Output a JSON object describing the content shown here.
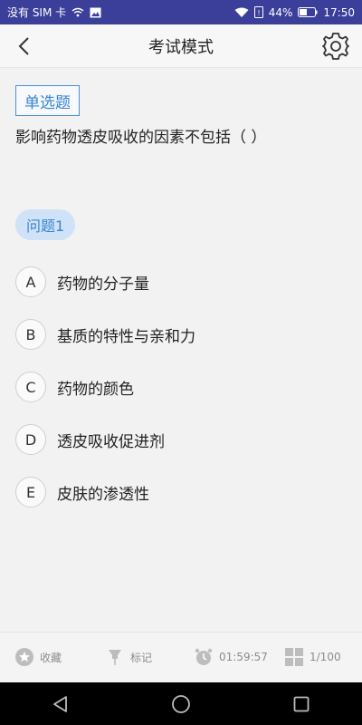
{
  "status_bar": {
    "carrier": "没有 SIM 卡",
    "battery": "44%",
    "time": "17:50"
  },
  "nav": {
    "title": "考试模式"
  },
  "question": {
    "type_label": "单选题",
    "text": "影响药物透皮吸收的因素不包括（ ）",
    "number_label": "问题1",
    "options": [
      {
        "letter": "A",
        "text": "药物的分子量"
      },
      {
        "letter": "B",
        "text": "基质的特性与亲和力"
      },
      {
        "letter": "C",
        "text": "药物的颜色"
      },
      {
        "letter": "D",
        "text": "透皮吸收促进剂"
      },
      {
        "letter": "E",
        "text": "皮肤的渗透性"
      }
    ]
  },
  "bottom_bar": {
    "favorite_label": "收藏",
    "mark_label": "标记",
    "timer": "01:59:57",
    "progress": "1/100"
  },
  "colors": {
    "status_bar": "#3b3f9a",
    "accent": "#3a85cf",
    "tag_fill": "#cfe2f7"
  }
}
